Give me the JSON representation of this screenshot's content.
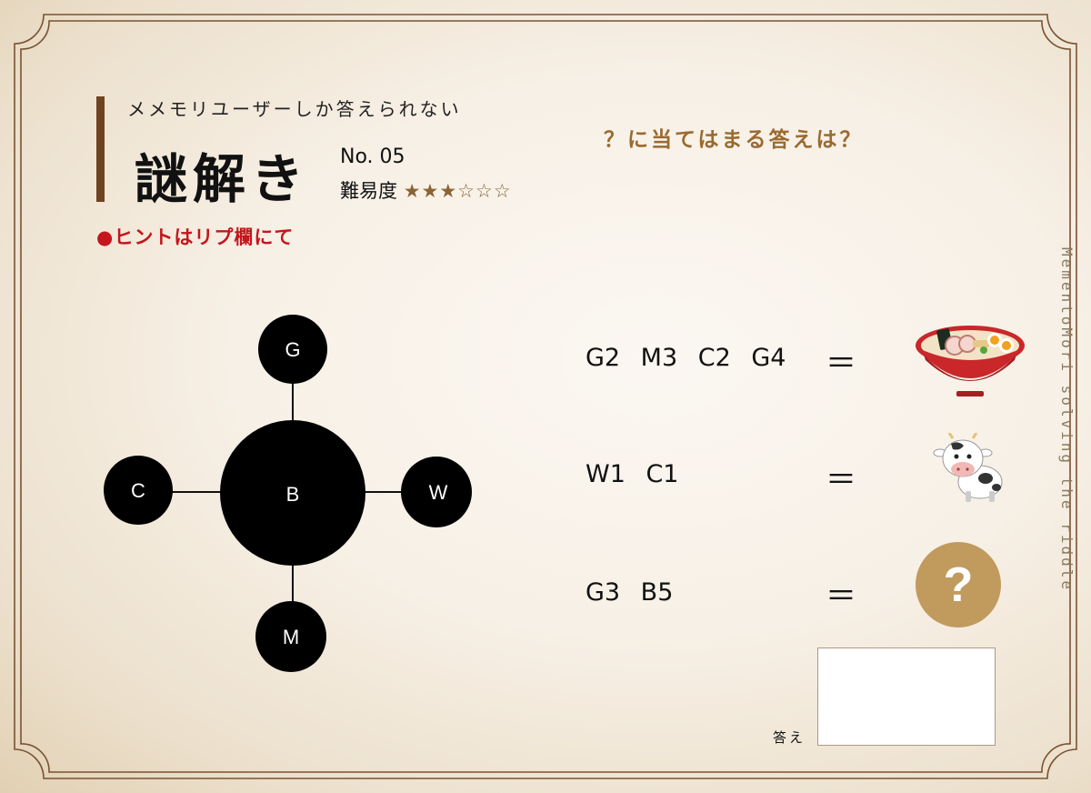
{
  "header": {
    "subtitle": "メメモリユーザーしか答えられない",
    "title": "謎解き",
    "puzzle_no": "No. 05",
    "difficulty_label": "難易度",
    "stars_filled": "★★★",
    "stars_empty": "☆☆☆",
    "hint": "●ヒントはリプ欄にて"
  },
  "question": "？に当てはまる答えは？",
  "side_text": "MementoMori solving the riddle",
  "diagram": {
    "center": "B",
    "top": "G",
    "left": "C",
    "right": "W",
    "bottom": "M"
  },
  "equations": [
    {
      "code": "G2 M3 C2 G4",
      "equals": "＝",
      "picture": "ramen-bowl"
    },
    {
      "code": "W1 C1",
      "equals": "＝",
      "picture": "cow"
    },
    {
      "code": "G3 B5",
      "equals": "＝",
      "picture": "question-mark"
    }
  ],
  "unknown_symbol": "?",
  "answer_label": "答え",
  "colors": {
    "accent_brown": "#6f4322",
    "hint_red": "#c4161c",
    "question_gold": "#c19a5e",
    "frame_brown": "#7a5234"
  }
}
